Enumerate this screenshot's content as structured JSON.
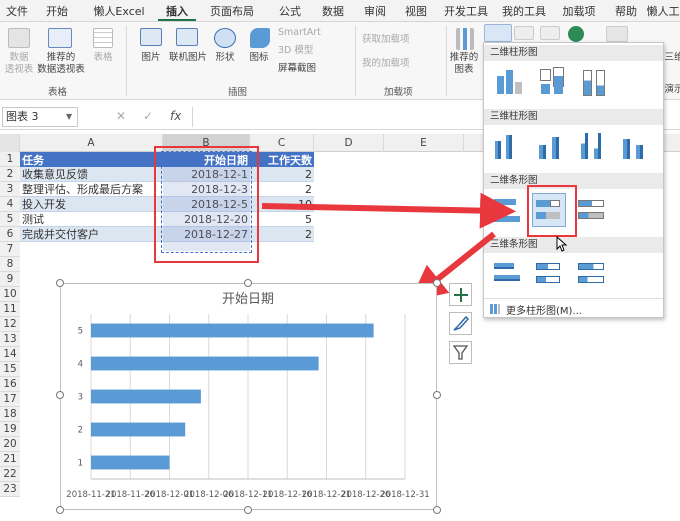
{
  "tabs": [
    "文件",
    "开始",
    "懒人Excel",
    "插入",
    "页面布局",
    "公式",
    "数据",
    "审阅",
    "视图",
    "开发工具",
    "我的工具",
    "加载项",
    "帮助",
    "懒人工"
  ],
  "ribbon": {
    "pivot_label": "数据\n透视表",
    "recommended_pivot_label": "推荐的\n数据透视表",
    "table_label": "表格",
    "group_tables": "表格",
    "picture_label": "图片",
    "online_picture_label": "联机图片",
    "shapes_label": "形状",
    "icons_label": "图标",
    "smartart_label": "SmartArt",
    "model3d_label": "3D 模型",
    "screenshot_label": "屏幕截图",
    "group_illustrations": "插图",
    "get_addins_label": "获取加载项",
    "my_addins_label": "我的加载项",
    "group_addins": "加载项",
    "recommended_charts_label": "推荐的\n图表",
    "right_cut_label1": "三维",
    "right_cut_label2": "演示"
  },
  "formula_bar": {
    "name_box": "图表 3",
    "cancel": "✕",
    "enter": "✓",
    "fx": "fx",
    "value": ""
  },
  "columns": [
    "A",
    "B",
    "C",
    "D",
    "E"
  ],
  "rows": [
    "1",
    "2",
    "3",
    "4",
    "5",
    "6",
    "7",
    "8",
    "9",
    "10",
    "11",
    "12",
    "13",
    "14",
    "15",
    "16",
    "17",
    "18",
    "19",
    "20",
    "21",
    "22",
    "23"
  ],
  "table": {
    "headers": [
      "任务",
      "开始日期",
      "工作天数"
    ],
    "rows": [
      [
        "收集意见反馈",
        "2018-12-1",
        "2"
      ],
      [
        "整理评估、形成最后方案",
        "2018-12-3",
        "2"
      ],
      [
        "投入开发",
        "2018-12-5",
        "10"
      ],
      [
        "测试",
        "2018-12-20",
        "5"
      ],
      [
        "完成并交付客户",
        "2018-12-27",
        "2"
      ]
    ]
  },
  "dropdown": {
    "section_2d_column": "二维柱形图",
    "section_3d_column": "三维柱形图",
    "section_2d_bar": "二维条形图",
    "section_3d_bar": "三维条形图",
    "more_charts": "更多柱形图(M)..."
  },
  "chart_data": {
    "type": "bar",
    "title": "开始日期",
    "categories": [
      "1",
      "2",
      "3",
      "4",
      "5"
    ],
    "values": [
      "2018-12-01",
      "2018-12-03",
      "2018-12-05",
      "2018-12-20",
      "2018-12-27"
    ],
    "xlim": [
      "2018-11-21",
      "2018-12-31"
    ],
    "x_tick_labels": [
      "2018-11-21",
      "2018-11-26",
      "2018-12-01",
      "2018-12-06",
      "2018-12-11",
      "2018-12-16",
      "2018-12-21",
      "2018-12-26",
      "2018-12-31"
    ],
    "orientation": "horizontal",
    "bar_color": "#5b9bd5",
    "grid": true
  },
  "colors": {
    "header_fill": "#4472c4",
    "band_fill": "#dce6f1",
    "highlight": "#e8383d",
    "excel_green": "#217346"
  }
}
